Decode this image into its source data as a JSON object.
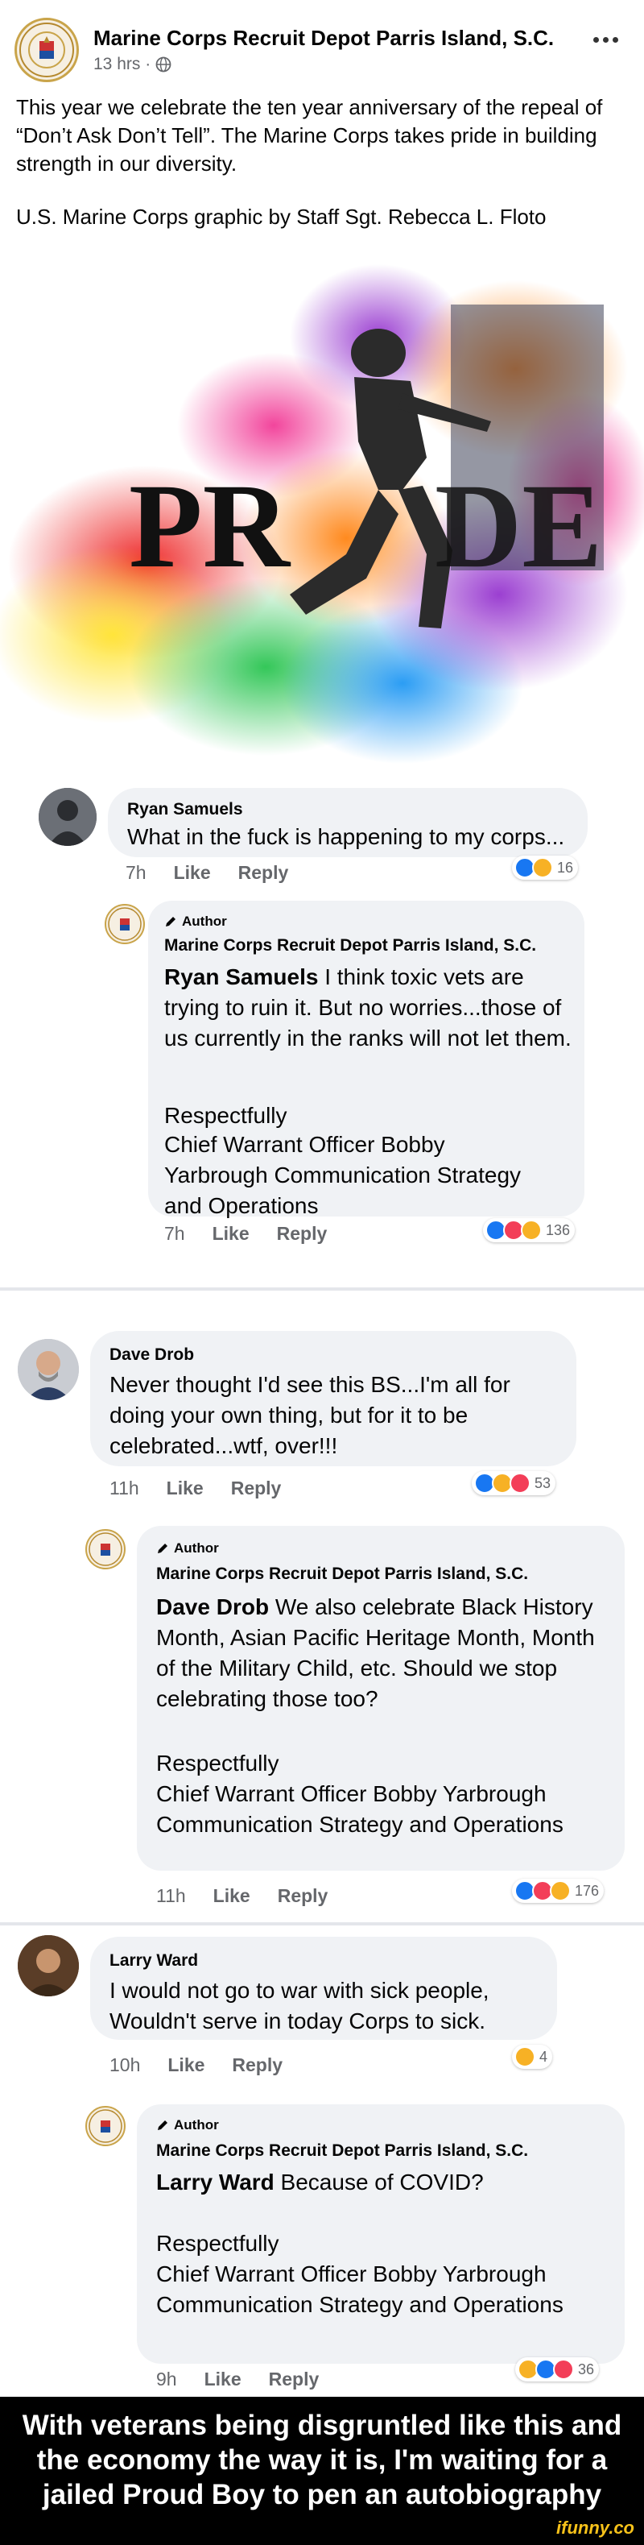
{
  "post": {
    "page_name": "Marine Corps Recruit Depot Parris Island, S.C.",
    "time": "13 hrs ·",
    "privacy_icon": "globe-icon",
    "text": "This year we celebrate the ten year anniversary of the repeal of “Don’t Ask Don’t Tell”. The Marine Corps takes pride in building strength in our diversity.",
    "credit": "U.S. Marine Corps graphic by Staff Sgt. Rebecca L. Floto",
    "graphic_word": "PRIDE"
  },
  "comments": [
    {
      "name": "Ryan Samuels",
      "text": "What in the fuck is happening to my corps...",
      "time": "7h",
      "like": "Like",
      "reply": "Reply",
      "reaction_icons": [
        "like-reaction-icon",
        "haha-reaction-icon"
      ],
      "reaction_count": "16",
      "reply_comment": {
        "author_tag": "Author",
        "name": "Marine Corps Recruit Depot Parris Island, S.C.",
        "mention": "Ryan Samuels",
        "text": " I think toxic vets are trying to ruin it. But no worries...those of us currently in the ranks will not let them.",
        "signoff": "Respectfully",
        "signature": "Chief Warrant Officer Bobby Yarbrough Communication Strategy and Operations",
        "time": "7h",
        "like": "Like",
        "reply": "Reply",
        "reaction_icons": [
          "like-reaction-icon",
          "love-reaction-icon",
          "haha-reaction-icon"
        ],
        "reaction_count": "136"
      }
    },
    {
      "name": "Dave Drob",
      "text": "Never thought I'd see this BS...I'm all for doing your own thing, but for it to be celebrated...wtf, over!!!",
      "time": "11h",
      "like": "Like",
      "reply": "Reply",
      "reaction_icons": [
        "like-reaction-icon",
        "haha-reaction-icon",
        "love-reaction-icon"
      ],
      "reaction_count": "53",
      "reply_comment": {
        "author_tag": "Author",
        "name": "Marine Corps Recruit Depot Parris Island, S.C.",
        "mention": "Dave Drob",
        "text": " We also celebrate Black History Month, Asian Pacific Heritage Month, Month of the Military Child, etc. Should we stop celebrating those too?",
        "signoff": "Respectfully",
        "signature": "Chief Warrant Officer Bobby Yarbrough Communication Strategy and Operations",
        "time": "11h",
        "like": "Like",
        "reply": "Reply",
        "reaction_icons": [
          "like-reaction-icon",
          "love-reaction-icon",
          "haha-reaction-icon"
        ],
        "reaction_count": "176"
      }
    },
    {
      "name": "Larry Ward",
      "text": "I would not go to war with sick people, Wouldn't serve in today Corps to sick.",
      "time": "10h",
      "like": "Like",
      "reply": "Reply",
      "reaction_icons": [
        "haha-reaction-icon"
      ],
      "reaction_count": "4",
      "reply_comment": {
        "author_tag": "Author",
        "name": "Marine Corps Recruit Depot Parris Island, S.C.",
        "mention": "Larry Ward",
        "text": " Because of COVID?",
        "signoff": "Respectfully",
        "signature": "Chief Warrant Officer Bobby Yarbrough Communication Strategy and Operations",
        "time": "9h",
        "like": "Like",
        "reply": "Reply",
        "reaction_icons": [
          "haha-reaction-icon",
          "like-reaction-icon",
          "love-reaction-icon"
        ],
        "reaction_count": "36"
      }
    }
  ],
  "caption": {
    "text": "With veterans being disgruntled like this and the economy the way it is, I'm waiting for a jailed Proud Boy to pen an autobiography",
    "watermark": "ifunny.co"
  },
  "colors": {
    "like": "#1877f2",
    "love": "#f33e58",
    "haha": "#f7b125",
    "bubble": "#f0f2f5",
    "muted_text": "#65676b"
  }
}
